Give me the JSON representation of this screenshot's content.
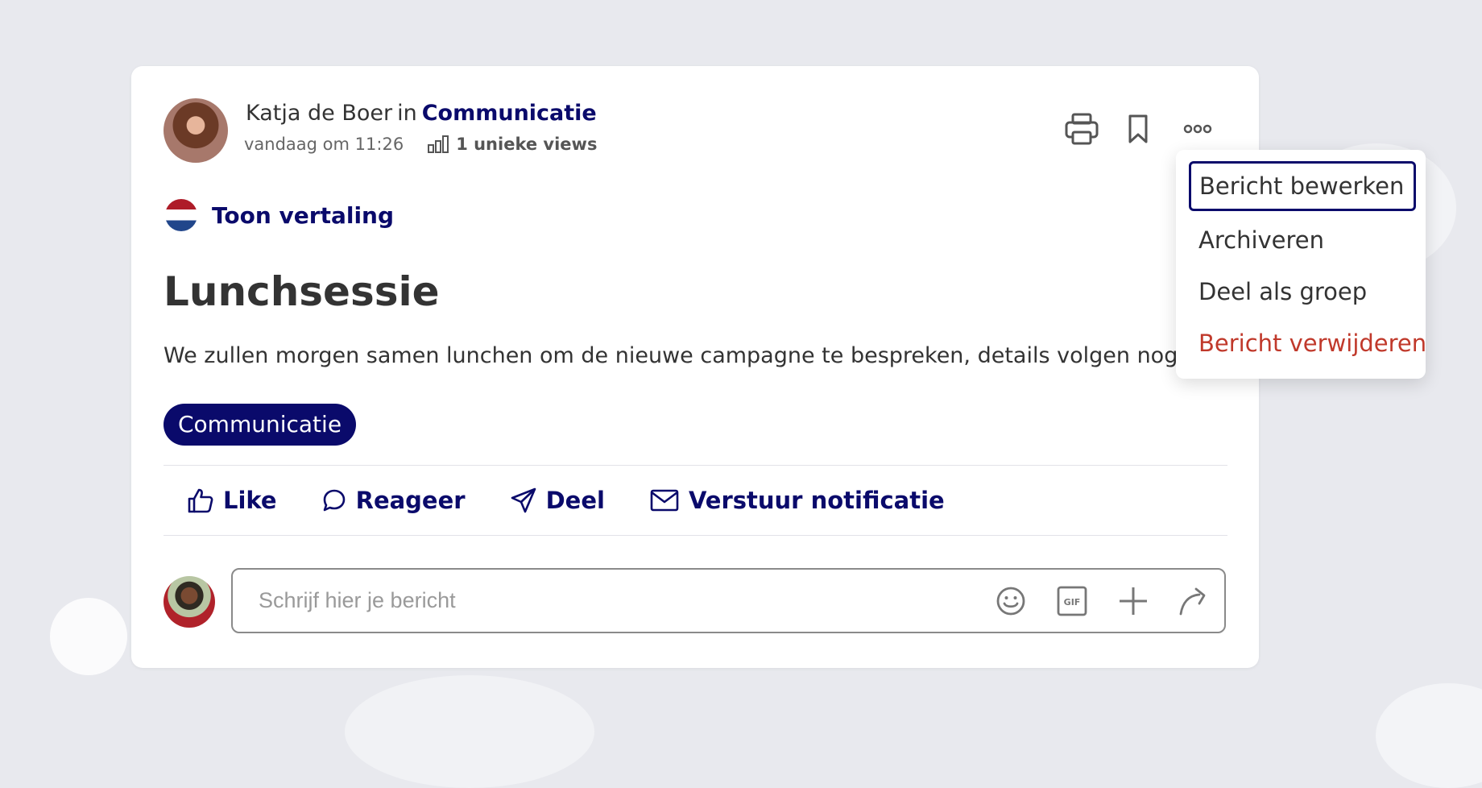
{
  "post": {
    "author_name": "Katja de Boer",
    "in_text": "in",
    "group_name": "Communicatie",
    "timestamp": "vandaag om 11:26",
    "views": "1 unieke views",
    "translate_label": "Toon vertaling",
    "title": "Lunchsessie",
    "body": "We zullen morgen samen lunchen om de nieuwe campagne te bespreken, details volgen nog.",
    "tag": "Communicatie"
  },
  "header_actions": {
    "print_icon": "printer-icon",
    "bookmark_icon": "bookmark-icon",
    "more_icon": "more-options-icon"
  },
  "actions": {
    "like": "Like",
    "reply": "Reageer",
    "share": "Deel",
    "notify": "Verstuur notificatie"
  },
  "comment": {
    "placeholder": "Schrijf hier je bericht",
    "icons": [
      "emoji-icon",
      "gif-icon",
      "plus-icon",
      "send-icon"
    ]
  },
  "menu": {
    "items": [
      "Bericht bewerken",
      "Archiveren",
      "Deel als groep",
      "Bericht verwijderen"
    ]
  },
  "colors": {
    "accent": "#0a0a6b",
    "danger": "#c0392b",
    "background": "#e8e9ee"
  }
}
